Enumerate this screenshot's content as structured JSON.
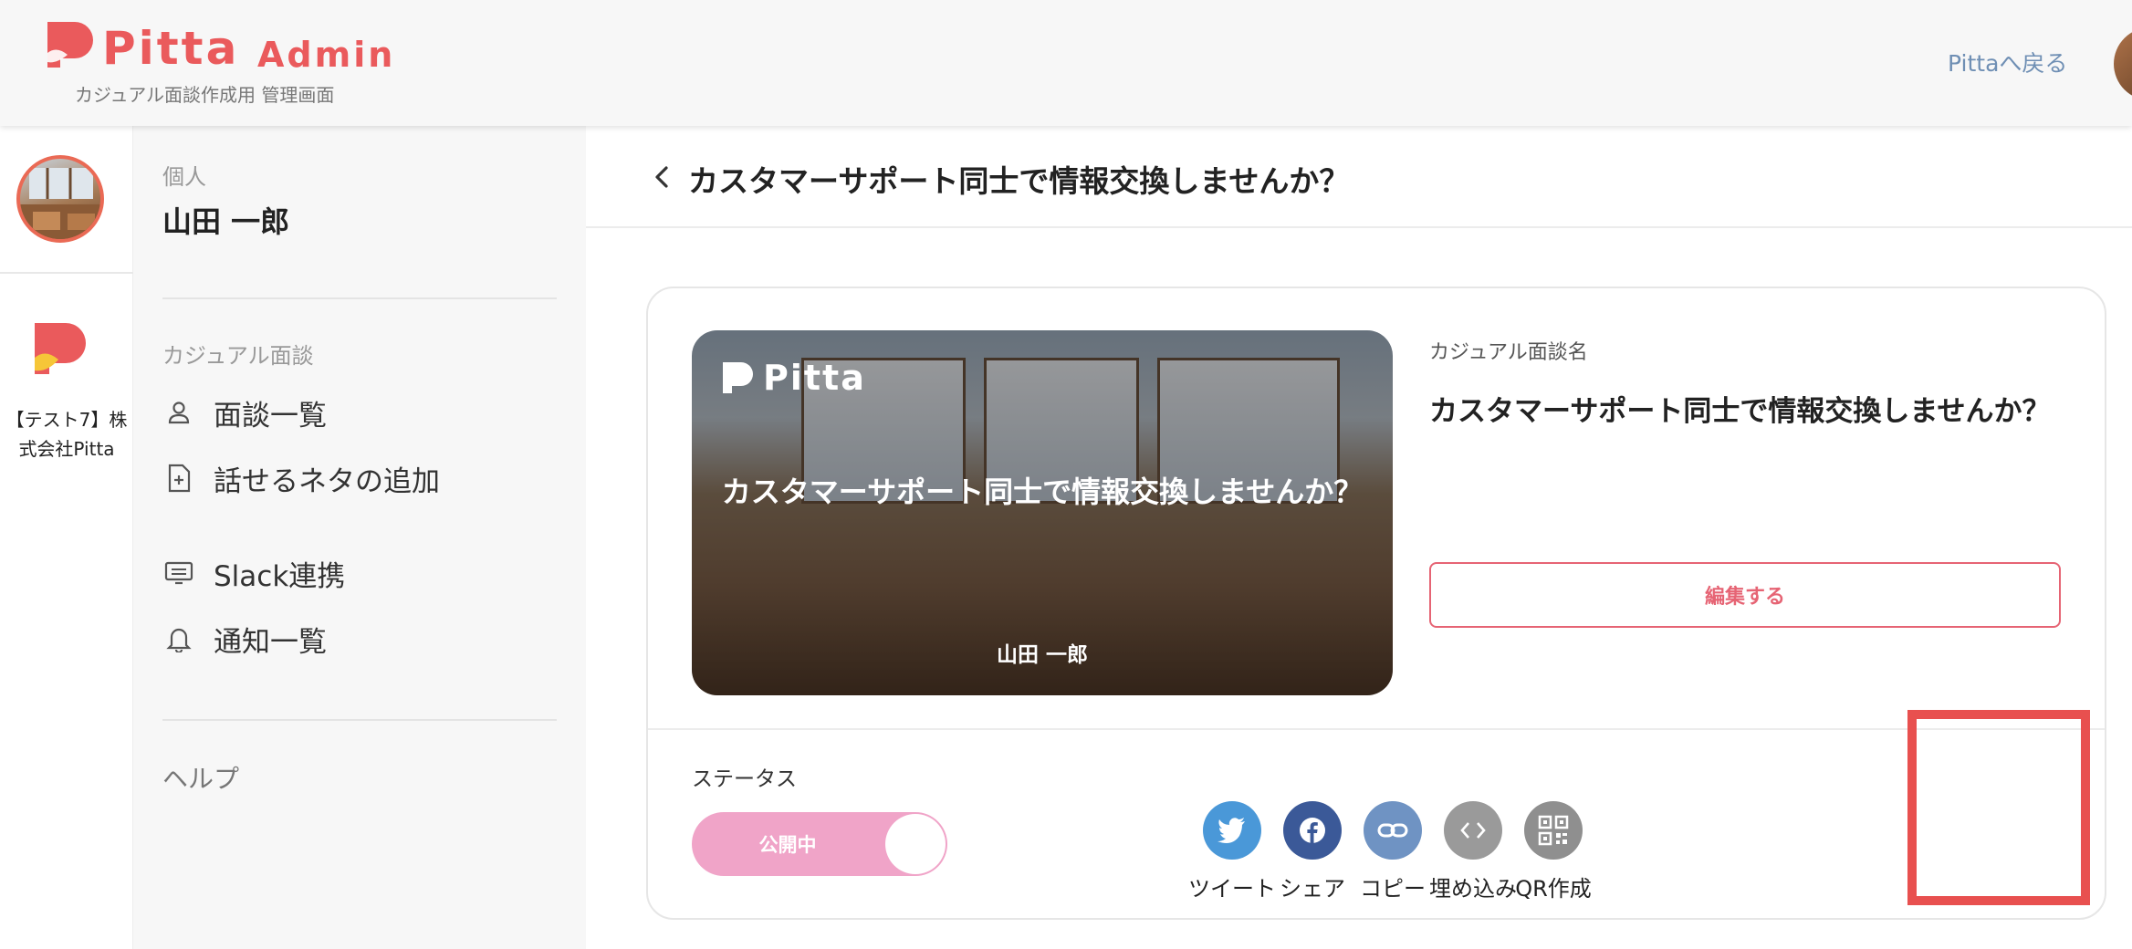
{
  "header": {
    "brand": "Pitta",
    "brand_suffix": "Admin",
    "subtitle": "カジュアル面談作成用 管理画面",
    "back_link": "Pittaへ戻る"
  },
  "rail": {
    "org_name": "【テスト7】株式会社Pitta"
  },
  "sidebar": {
    "account_type": "個人",
    "user_name": "山田 一郎",
    "section_casual": "カジュアル面談",
    "items": [
      {
        "label": "面談一覧",
        "icon": "person-icon"
      },
      {
        "label": "話せるネタの追加",
        "icon": "file-plus-icon"
      },
      {
        "label": "Slack連携",
        "icon": "slack-monitor-icon"
      },
      {
        "label": "通知一覧",
        "icon": "bell-icon"
      }
    ],
    "help": "ヘルプ"
  },
  "page": {
    "title": "カスタマーサポート同士で情報交換しませんか？"
  },
  "card": {
    "thumb_logo": "Pitta",
    "thumb_title": "カスタマーサポート同士で情報交換しませんか？",
    "thumb_user": "山田 一郎",
    "name_label": "カジュアル面談名",
    "name_value": "カスタマーサポート同士で情報交換しませんか？",
    "edit_button": "編集する",
    "status_label": "ステータス",
    "status_value": "公開中",
    "status_on": true,
    "share": [
      {
        "label": "ツイート",
        "icon": "twitter-icon",
        "color": "#4a98d8"
      },
      {
        "label": "シェア",
        "icon": "facebook-icon",
        "color": "#3b5998"
      },
      {
        "label": "コピー",
        "icon": "link-icon",
        "color": "#6f93c3"
      },
      {
        "label": "埋め込み",
        "icon": "code-icon",
        "color": "#9a9a9a"
      },
      {
        "label": "QR作成",
        "icon": "qr-code-icon",
        "color": "#8f8f8f"
      }
    ]
  },
  "colors": {
    "brand": "#ea5a5c",
    "link": "#6f8fb4",
    "edit": "#e66474",
    "toggle": "#f0a4c8",
    "highlight": "#e8504f"
  }
}
